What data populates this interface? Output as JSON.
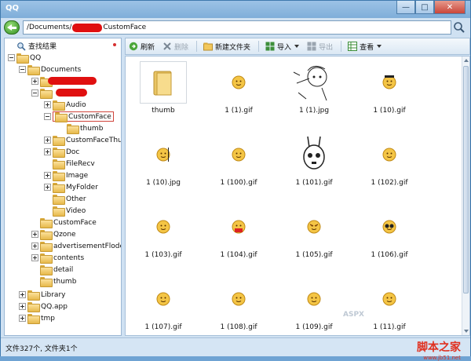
{
  "window": {
    "title": "QQ"
  },
  "address": {
    "prefix": "/Documents/",
    "suffix": "CustomFace"
  },
  "tree": {
    "search_label": "查找结果",
    "root": "QQ",
    "documents": "Documents",
    "audio": "Audio",
    "customface": "CustomFace",
    "thumb_child": "thumb",
    "customfacethumb": "CustomFaceThu",
    "doc": "Doc",
    "filerecv": "FileRecv",
    "image": "Image",
    "myfolder": "MyFolder",
    "other": "Other",
    "video": "Video",
    "customface2": "CustomFace",
    "qzone": "Qzone",
    "advertisement": "advertisementFlode",
    "contents": "contents",
    "detail": "detail",
    "thumb2": "thumb",
    "library": "Library",
    "qqapp": "QQ.app",
    "tmp": "tmp"
  },
  "toolbar": {
    "refresh": "刷新",
    "delete": "删除",
    "new_folder": "新建文件夹",
    "import": "导入",
    "export": "导出",
    "view": "查看"
  },
  "files": [
    {
      "name": "thumb",
      "kind": "folder"
    },
    {
      "name": "1 (1).gif",
      "kind": "smiley"
    },
    {
      "name": "1 (1).jpg",
      "kind": "sketch"
    },
    {
      "name": "1 (10).gif",
      "kind": "smiley-hat"
    },
    {
      "name": "1 (10).jpg",
      "kind": "smiley-small"
    },
    {
      "name": "1 (100).gif",
      "kind": "smiley"
    },
    {
      "name": "1 (101).gif",
      "kind": "rabbit"
    },
    {
      "name": "1 (102).gif",
      "kind": "smiley"
    },
    {
      "name": "1 (103).gif",
      "kind": "smiley"
    },
    {
      "name": "1 (104).gif",
      "kind": "smiley-red"
    },
    {
      "name": "1 (105).gif",
      "kind": "smiley-angry"
    },
    {
      "name": "1 (106).gif",
      "kind": "smiley-dark"
    },
    {
      "name": "1 (107).gif",
      "kind": "smiley"
    },
    {
      "name": "1 (108).gif",
      "kind": "smiley"
    },
    {
      "name": "1 (109).gif",
      "kind": "smiley"
    },
    {
      "name": "1 (11).gif",
      "kind": "smiley"
    }
  ],
  "status": {
    "text": "文件327个, 文件夹1个"
  },
  "watermark": {
    "main": "脚本之家",
    "sub": "www.jb51.net"
  },
  "colors": {
    "redaction": "#e01010",
    "selection_border": "#d0443b",
    "accent": "#3f79ad"
  }
}
